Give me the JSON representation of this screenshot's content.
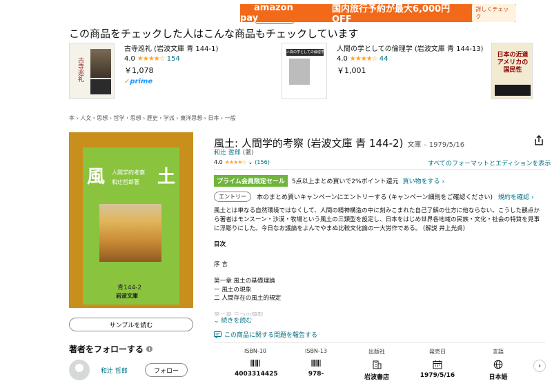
{
  "banner": {
    "logo": "amazon pay",
    "headline": "国内旅行予約が最大6,000円OFF",
    "cta": "詳しくチェック",
    "colors": {
      "background": "#f26a19",
      "smile": "#ff9900"
    }
  },
  "recommendations": {
    "title": "この商品をチェックした人はこんな商品もチェックしています",
    "items": [
      {
        "title": "古寺巡礼 (岩波文庫 青 144-1)",
        "rating": "4.0",
        "stars": "★★★★☆",
        "count": "154",
        "price": "￥1,078",
        "prime": "prime",
        "cover_text": "古寺巡礼"
      },
      {
        "title": "人間の学としての倫理学 (岩波文庫 青 144-13)",
        "rating": "4.0",
        "stars": "★★★★☆",
        "count": "44",
        "price": "￥1,001",
        "prime": "",
        "cover_text": "人間の学としての倫理学"
      },
      {
        "title": "",
        "rating": "",
        "stars": "",
        "count": "",
        "price": "",
        "prime": "",
        "cover_text": "日本の近道 アメリカの国民性"
      }
    ]
  },
  "breadcrumb": "本 › 人文・思想 › 哲学・思想 › 歴史・学派 › 東洋思想 › 日本 › 一般",
  "cover": {
    "kanji_left": "風",
    "kanji_right": "土",
    "subtitle": "人間学的考察",
    "author": "和辻哲郎著",
    "number": "青144-2",
    "publisher": "岩波文庫"
  },
  "sample_button": "サンプルを読む",
  "follow": {
    "title": "著者をフォローする",
    "author": "和辻 哲郎",
    "button": "フォロー"
  },
  "product": {
    "title": "風土: 人間学的考察 (岩波文庫 青 144-2)",
    "format_meta": "文庫 – 1979/5/16",
    "author": "和辻 哲郎",
    "author_role": " (著)",
    "rating": "4.0",
    "stars": "★★★★☆",
    "rating_count": "(156)",
    "formats_link": "すべてのフォーマットとエディションを表示",
    "promo_badge": "プライム会員限定セール",
    "promo_text": "5点以上まとめ買いで2%ポイント還元",
    "promo_link": "買い物をする ›",
    "entry_button": "エントリー",
    "entry_text": "本のまとめ買いキャンペーンにエントリーする (キャンペーン細則をご確認ください)",
    "entry_link": "規約を確認 ›",
    "description": "風土とは単なる自然環境ではなくして、人間の精神構造の中に刻みこまれた自己了解の仕方に他ならない。こうした観点から著者はモンスーン・沙漠・牧場という風土の三類型を設定し、日本をはじめ世界各地域の民族・文化・社会の特質を見事に浮彫りにした。今日なお議論をよんでやまぬ比較文化論の一大労作である。 (解説 井上光貞)",
    "toc_title": "目次",
    "toc_intro": "序 言",
    "toc_ch1": "第一章 風土の基礎理論",
    "toc_ch1_s1": "一 風土の現象",
    "toc_ch1_s2": "二 人間存在の風土的規定",
    "toc_ch2": "第二章 三つの類型",
    "read_more": "続きを読む",
    "report_link": "この商品に関する問題を報告する"
  },
  "details": [
    {
      "label": "ISBN-10",
      "icon": "barcode-icon",
      "value": "4003314425"
    },
    {
      "label": "ISBN-13",
      "icon": "barcode-icon",
      "value": "978-"
    },
    {
      "label": "出版社",
      "icon": "building-icon",
      "value": "岩波書店"
    },
    {
      "label": "発売日",
      "icon": "calendar-icon",
      "value": "1979/5/16"
    },
    {
      "label": "言語",
      "icon": "globe-icon",
      "value": "日本語"
    }
  ]
}
